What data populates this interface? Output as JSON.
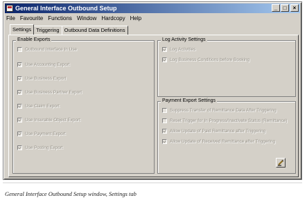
{
  "window": {
    "title": "General Interface Outbound Setup",
    "controls": {
      "minimize": "_",
      "maximize": "□",
      "close": "×"
    }
  },
  "menu": [
    "File",
    "Favourite",
    "Functions",
    "Window",
    "Hardcopy",
    "Help"
  ],
  "tabs": [
    {
      "label": "Settings",
      "active": true
    },
    {
      "label": "Triggering",
      "active": false
    },
    {
      "label": "Outbound Data Definitions",
      "active": false
    }
  ],
  "enable_exports": {
    "title": "Enable Exports",
    "items": [
      {
        "label": "Outbound Interface In Use",
        "checked": false
      },
      {
        "label": "Use Accounting Export",
        "checked": true
      },
      {
        "label": "Use Business Export",
        "checked": true
      },
      {
        "label": "Use Business Partner Export",
        "checked": true
      },
      {
        "label": "Use Claim Export",
        "checked": true
      },
      {
        "label": "Use Insurable Object Export",
        "checked": true
      },
      {
        "label": "Use Payment Export",
        "checked": true
      },
      {
        "label": "Use Posting Export",
        "checked": true
      }
    ]
  },
  "log_activity": {
    "title": "Log Activity Settings",
    "items": [
      {
        "label": "Log Activities",
        "checked": true
      },
      {
        "label": "Log Business Conditions before Booking",
        "checked": true
      }
    ]
  },
  "payment_export": {
    "title": "Payment Export Settings",
    "items": [
      {
        "label": "Suppress Transfer of Remittance Data After Triggering",
        "checked": false
      },
      {
        "label": "Reset Trigger for In Progress/Inactivate Status (Remittance)",
        "checked": false
      },
      {
        "label": "Allow Update of Paid Remittance after Triggering",
        "checked": true
      },
      {
        "label": "Allow Update of Received Remittance after Triggering",
        "checked": true
      }
    ]
  },
  "edit_icon": "edit-pencil-icon",
  "caption": "General Interface Outbound Setup window, Settings tab"
}
